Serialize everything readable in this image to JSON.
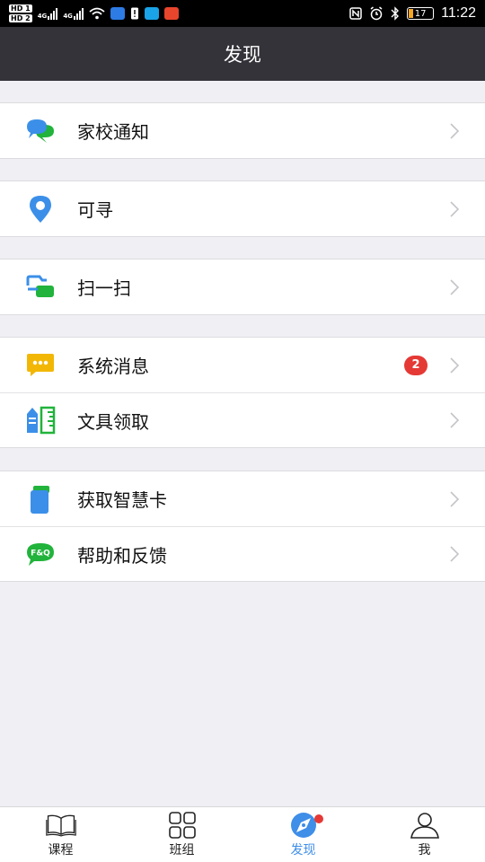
{
  "status_bar": {
    "time": "11:22",
    "battery": "17",
    "network_left": "4G",
    "network_right": "4G",
    "hd1": "HD 1",
    "hd2": "HD 2"
  },
  "header": {
    "title": "发现"
  },
  "groups": [
    {
      "items": [
        {
          "label": "家校通知",
          "icon": "chat-bubbles-icon"
        }
      ]
    },
    {
      "items": [
        {
          "label": "可寻",
          "icon": "location-pin-icon"
        }
      ]
    },
    {
      "items": [
        {
          "label": "扫一扫",
          "icon": "scan-icon"
        }
      ]
    },
    {
      "items": [
        {
          "label": "系统消息",
          "icon": "message-dots-icon",
          "badge": "2"
        },
        {
          "label": "文具领取",
          "icon": "stationery-icon"
        }
      ]
    },
    {
      "items": [
        {
          "label": "获取智慧卡",
          "icon": "smart-card-icon"
        },
        {
          "label": "帮助和反馈",
          "icon": "faq-icon",
          "icon_text": "F&Q"
        }
      ]
    }
  ],
  "tabbar": {
    "tabs": [
      {
        "label": "课程",
        "icon": "book-icon"
      },
      {
        "label": "班组",
        "icon": "grid-icon"
      },
      {
        "label": "发现",
        "icon": "compass-icon",
        "active": true
      },
      {
        "label": "我",
        "icon": "person-icon"
      }
    ]
  },
  "colors": {
    "header_bg": "#333339",
    "page_bg": "#efeff4",
    "active_tab": "#3f8ee8",
    "badge": "#e53935"
  }
}
